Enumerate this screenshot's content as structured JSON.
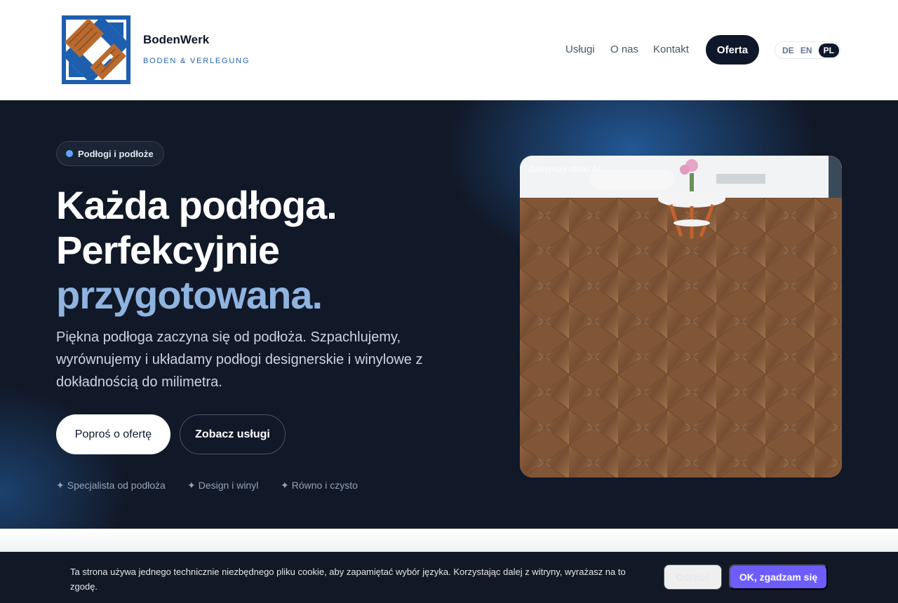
{
  "header": {
    "brand_name": "BodenWerk",
    "brand_tagline": "BODEN & VERLEGUNG",
    "nav": [
      {
        "label": "Usługi"
      },
      {
        "label": "O nas"
      },
      {
        "label": "Kontakt"
      }
    ],
    "cta_label": "Oferta",
    "languages": [
      {
        "label": "DE",
        "active": false
      },
      {
        "label": "EN",
        "active": false
      },
      {
        "label": "PL",
        "active": true
      }
    ]
  },
  "hero": {
    "badge": "Podłogi i podłoże",
    "title_line1": "Każda podłoga.",
    "title_line2": "Perfekcyjnie",
    "title_line3": "przygotowana.",
    "lead": "Piękna podłoga zaczyna się od podłoża. Szpachlujemy, wyrównujemy i układamy podłogi designerskie i winylowe z dokładnością do milimetra.",
    "primary_button": "Poproś o ofertę",
    "secondary_button": "Zobacz usługi",
    "features": [
      {
        "label": "Specjalista od podłoża"
      },
      {
        "label": "Design i winyl"
      },
      {
        "label": "Równo i czysto"
      }
    ],
    "feature_icon": "✦",
    "image_caption": "Zastępczy obraz AI"
  },
  "cookie": {
    "text": "Ta strona używa jednego technicznie niezbędnego pliku cookie, aby zapamiętać wybór języka. Korzystając dalej z witryny, wyrażasz na to zgodę.",
    "reject_label": "Odrzuć",
    "accept_label": "OK, zgadzam się"
  },
  "colors": {
    "brand_blue": "#2563a8",
    "dark": "#0f172a",
    "accent_text": "#8fb4e0",
    "accept_button": "#6d5dfc"
  }
}
